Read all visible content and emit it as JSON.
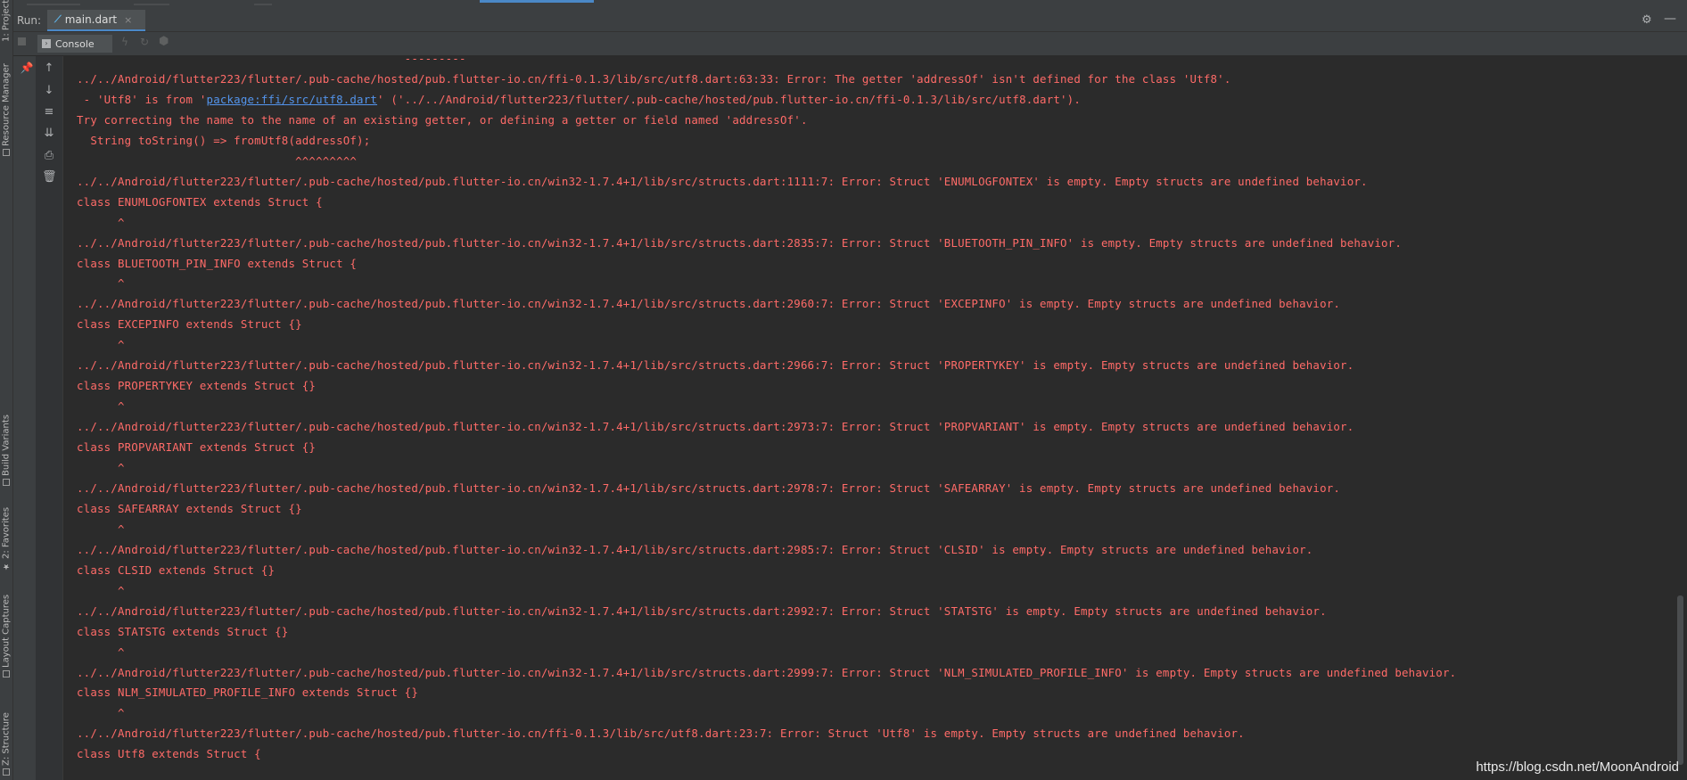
{
  "left_strip": {
    "tabs": [
      {
        "label": "1: Project",
        "icon": "project-icon"
      },
      {
        "label": "Resource Manager",
        "icon": "resource-manager-icon"
      },
      {
        "label": "Build Variants",
        "icon": "build-variants-icon"
      },
      {
        "label": "2: Favorites",
        "icon": "star-icon"
      },
      {
        "label": "Layout Captures",
        "icon": "layout-captures-icon"
      },
      {
        "label": "Z: Structure",
        "icon": "structure-icon"
      }
    ]
  },
  "run_bar": {
    "label": "Run:",
    "tab_title": "main.dart",
    "tab_close": "×"
  },
  "console_bar": {
    "tab_label": "Console"
  },
  "console": {
    "lines": [
      {
        "text": "                                                ---------"
      },
      {
        "text": "../../Android/flutter223/flutter/.pub-cache/hosted/pub.flutter-io.cn/ffi-0.1.3/lib/src/utf8.dart:63:33: Error: The getter 'addressOf' isn't defined for the class 'Utf8'."
      },
      {
        "prefix": " - 'Utf8' is from '",
        "link": "package:ffi/src/utf8.dart",
        "suffix": "' ('../../Android/flutter223/flutter/.pub-cache/hosted/pub.flutter-io.cn/ffi-0.1.3/lib/src/utf8.dart')."
      },
      {
        "text": "Try correcting the name to the name of an existing getter, or defining a getter or field named 'addressOf'."
      },
      {
        "text": "  String toString() => fromUtf8(addressOf);"
      },
      {
        "text": "                                ^^^^^^^^^"
      },
      {
        "text": "../../Android/flutter223/flutter/.pub-cache/hosted/pub.flutter-io.cn/win32-1.7.4+1/lib/src/structs.dart:1111:7: Error: Struct 'ENUMLOGFONTEX' is empty. Empty structs are undefined behavior."
      },
      {
        "text": "class ENUMLOGFONTEX extends Struct {"
      },
      {
        "text": "      ^"
      },
      {
        "text": "../../Android/flutter223/flutter/.pub-cache/hosted/pub.flutter-io.cn/win32-1.7.4+1/lib/src/structs.dart:2835:7: Error: Struct 'BLUETOOTH_PIN_INFO' is empty. Empty structs are undefined behavior."
      },
      {
        "text": "class BLUETOOTH_PIN_INFO extends Struct {"
      },
      {
        "text": "      ^"
      },
      {
        "text": "../../Android/flutter223/flutter/.pub-cache/hosted/pub.flutter-io.cn/win32-1.7.4+1/lib/src/structs.dart:2960:7: Error: Struct 'EXCEPINFO' is empty. Empty structs are undefined behavior."
      },
      {
        "text": "class EXCEPINFO extends Struct {}"
      },
      {
        "text": "      ^"
      },
      {
        "text": "../../Android/flutter223/flutter/.pub-cache/hosted/pub.flutter-io.cn/win32-1.7.4+1/lib/src/structs.dart:2966:7: Error: Struct 'PROPERTYKEY' is empty. Empty structs are undefined behavior."
      },
      {
        "text": "class PROPERTYKEY extends Struct {}"
      },
      {
        "text": "      ^"
      },
      {
        "text": "../../Android/flutter223/flutter/.pub-cache/hosted/pub.flutter-io.cn/win32-1.7.4+1/lib/src/structs.dart:2973:7: Error: Struct 'PROPVARIANT' is empty. Empty structs are undefined behavior."
      },
      {
        "text": "class PROPVARIANT extends Struct {}"
      },
      {
        "text": "      ^"
      },
      {
        "text": "../../Android/flutter223/flutter/.pub-cache/hosted/pub.flutter-io.cn/win32-1.7.4+1/lib/src/structs.dart:2978:7: Error: Struct 'SAFEARRAY' is empty. Empty structs are undefined behavior."
      },
      {
        "text": "class SAFEARRAY extends Struct {}"
      },
      {
        "text": "      ^"
      },
      {
        "text": "../../Android/flutter223/flutter/.pub-cache/hosted/pub.flutter-io.cn/win32-1.7.4+1/lib/src/structs.dart:2985:7: Error: Struct 'CLSID' is empty. Empty structs are undefined behavior."
      },
      {
        "text": "class CLSID extends Struct {}"
      },
      {
        "text": "      ^"
      },
      {
        "text": "../../Android/flutter223/flutter/.pub-cache/hosted/pub.flutter-io.cn/win32-1.7.4+1/lib/src/structs.dart:2992:7: Error: Struct 'STATSTG' is empty. Empty structs are undefined behavior."
      },
      {
        "text": "class STATSTG extends Struct {}"
      },
      {
        "text": "      ^"
      },
      {
        "text": "../../Android/flutter223/flutter/.pub-cache/hosted/pub.flutter-io.cn/win32-1.7.4+1/lib/src/structs.dart:2999:7: Error: Struct 'NLM_SIMULATED_PROFILE_INFO' is empty. Empty structs are undefined behavior."
      },
      {
        "text": "class NLM_SIMULATED_PROFILE_INFO extends Struct {}"
      },
      {
        "text": "      ^"
      },
      {
        "text": "../../Android/flutter223/flutter/.pub-cache/hosted/pub.flutter-io.cn/ffi-0.1.3/lib/src/utf8.dart:23:7: Error: Struct 'Utf8' is empty. Empty structs are undefined behavior."
      },
      {
        "text": "class Utf8 extends Struct {"
      }
    ]
  },
  "watermark": "https://blog.csdn.net/MoonAndroid",
  "colors": {
    "error_text": "#ff6b68",
    "link": "#5394ec",
    "background": "#2b2b2b",
    "panel": "#3c3f41"
  }
}
